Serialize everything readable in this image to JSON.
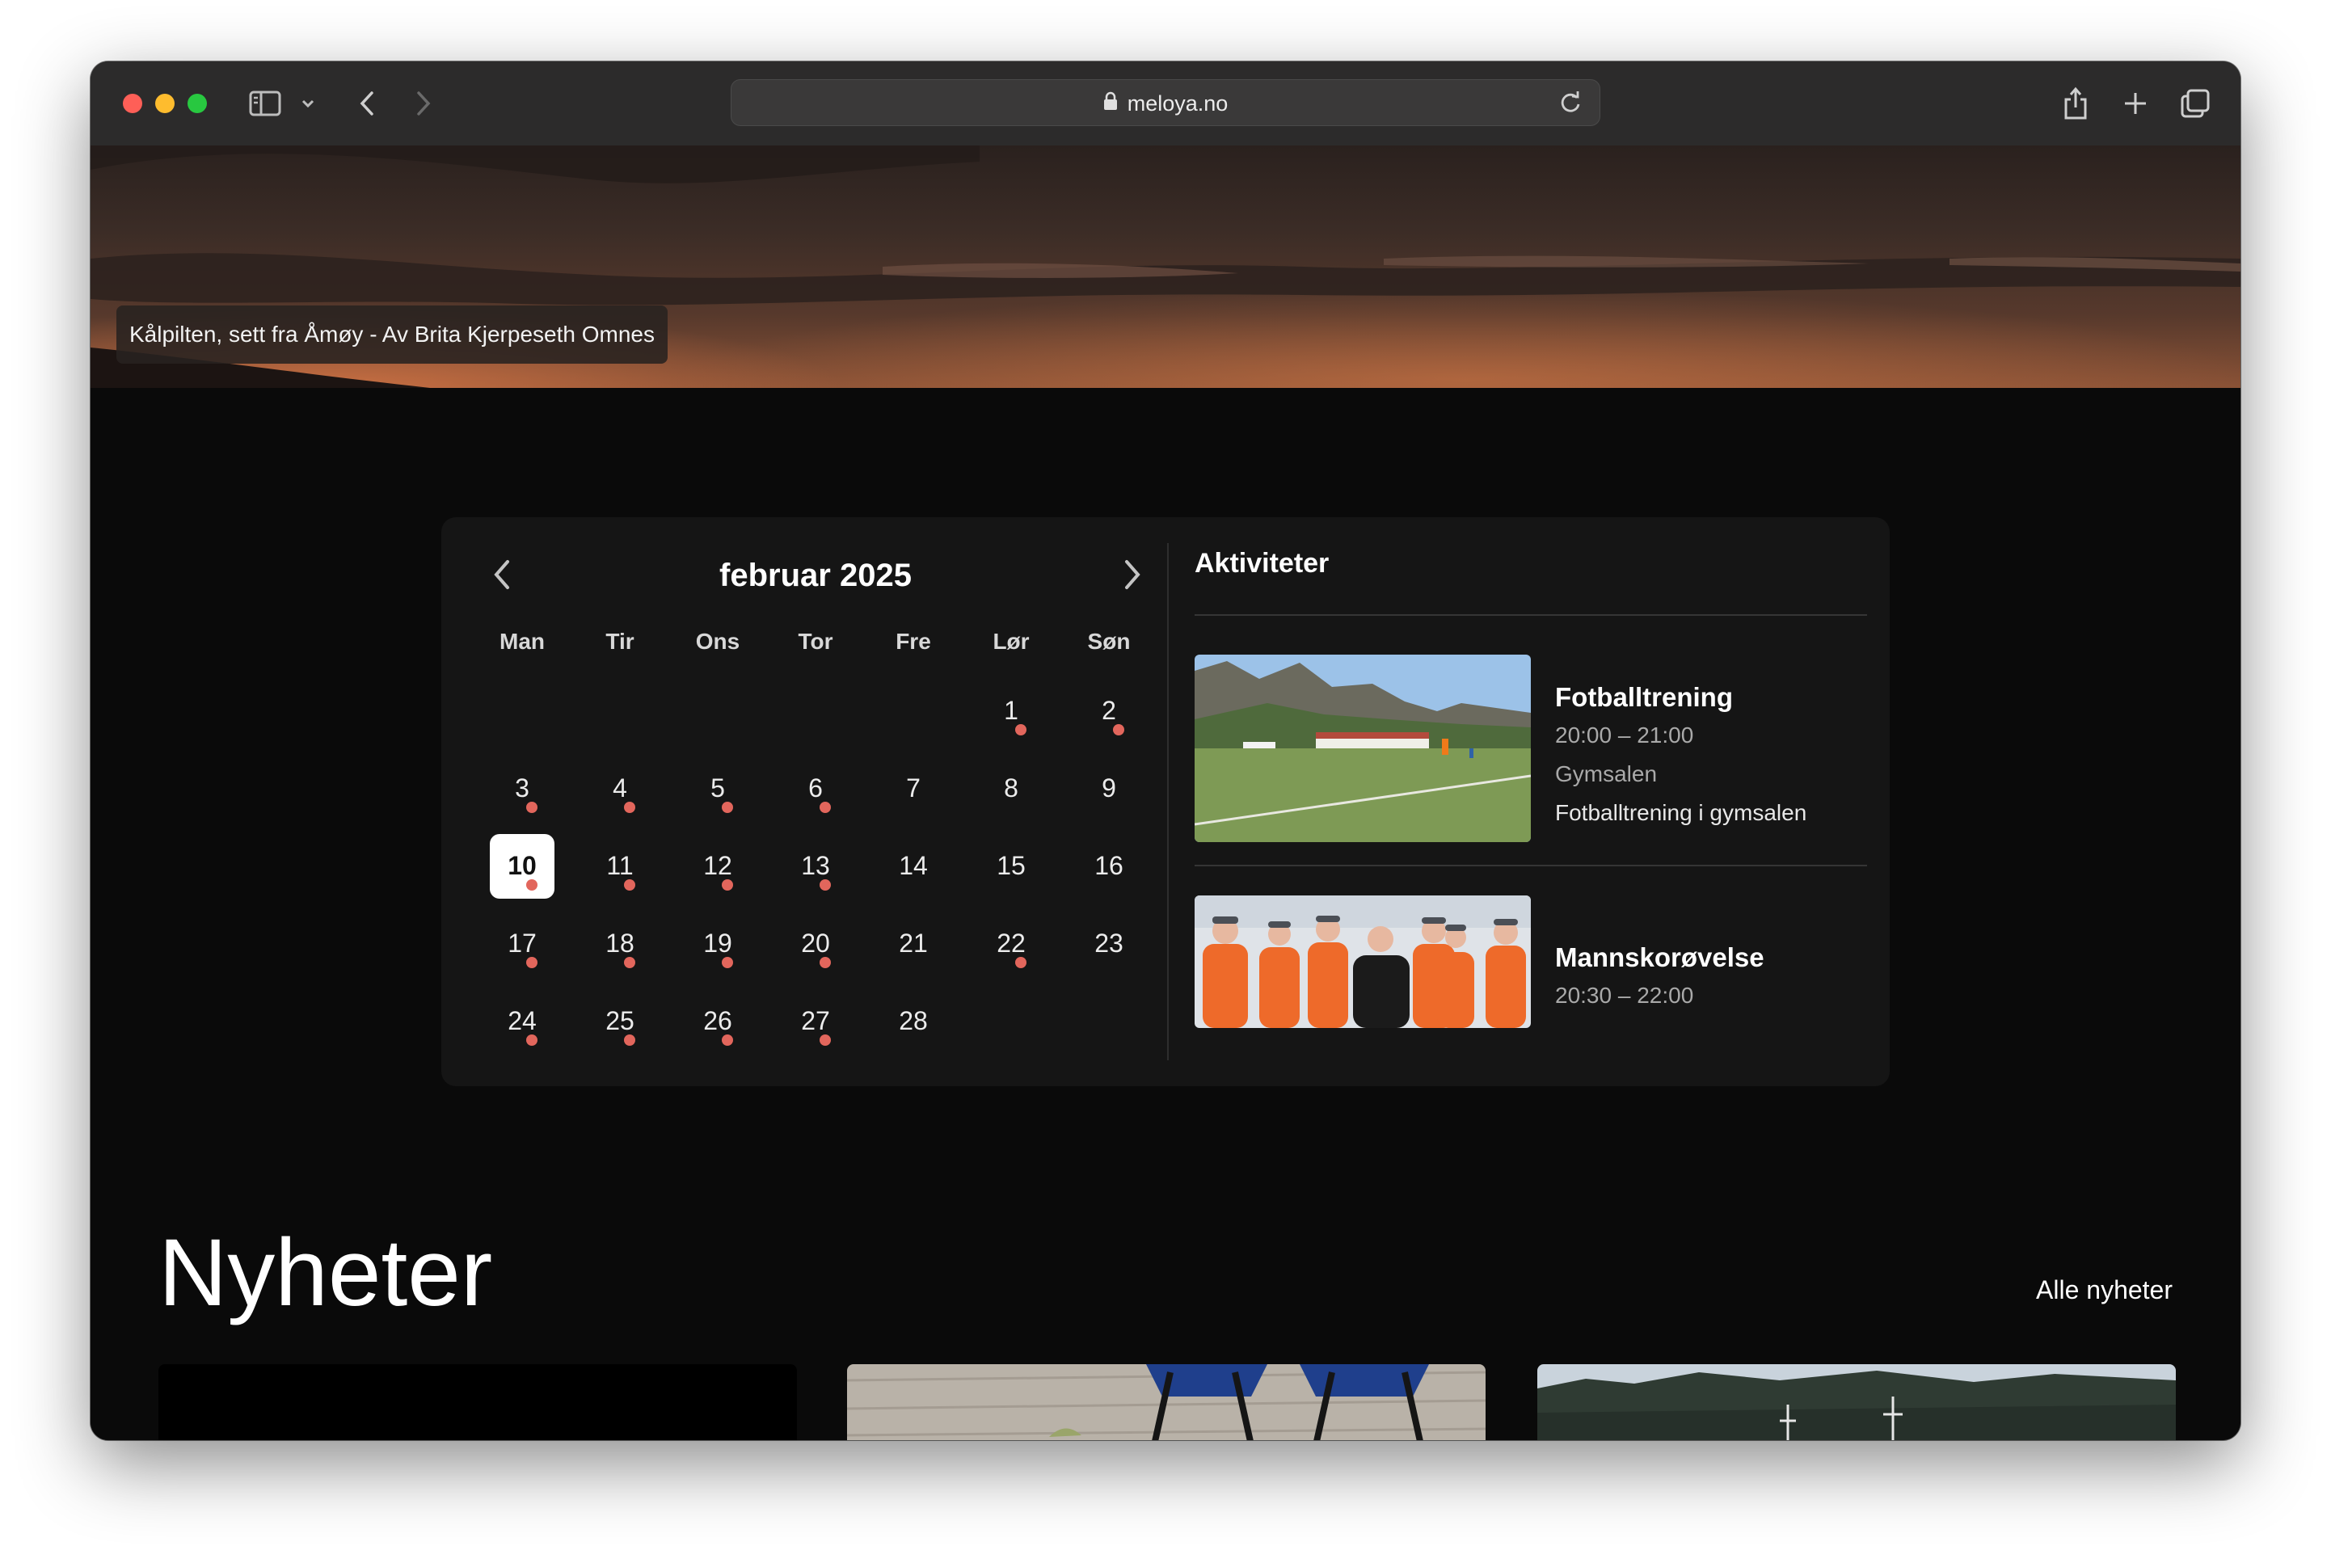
{
  "browser": {
    "url": "meloya.no"
  },
  "hero": {
    "caption": "Kålpilten, sett fra Åmøy - Av Brita Kjerpeseth Omnes"
  },
  "calendar": {
    "month_title": "februar 2025",
    "weekdays": [
      "Man",
      "Tir",
      "Ons",
      "Tor",
      "Fre",
      "Lør",
      "Søn"
    ],
    "today": "10",
    "days": [
      {
        "label": "1",
        "event": true
      },
      {
        "label": "2",
        "event": true
      },
      {
        "label": "3",
        "event": true
      },
      {
        "label": "4",
        "event": true
      },
      {
        "label": "5",
        "event": true
      },
      {
        "label": "6",
        "event": true
      },
      {
        "label": "7",
        "event": false
      },
      {
        "label": "8",
        "event": false
      },
      {
        "label": "9",
        "event": false
      },
      {
        "label": "10",
        "event": true
      },
      {
        "label": "11",
        "event": true
      },
      {
        "label": "12",
        "event": true
      },
      {
        "label": "13",
        "event": true
      },
      {
        "label": "14",
        "event": false
      },
      {
        "label": "15",
        "event": false
      },
      {
        "label": "16",
        "event": false
      },
      {
        "label": "17",
        "event": true
      },
      {
        "label": "18",
        "event": true
      },
      {
        "label": "19",
        "event": true
      },
      {
        "label": "20",
        "event": true
      },
      {
        "label": "21",
        "event": false
      },
      {
        "label": "22",
        "event": true
      },
      {
        "label": "23",
        "event": false
      },
      {
        "label": "24",
        "event": true
      },
      {
        "label": "25",
        "event": true
      },
      {
        "label": "26",
        "event": true
      },
      {
        "label": "27",
        "event": true
      },
      {
        "label": "28",
        "event": false
      }
    ],
    "dot_color": "#e2665c"
  },
  "activities": {
    "title": "Aktiviteter",
    "items": [
      {
        "name": "Fotballtrening",
        "time": "20:00 – 21:00",
        "location": "Gymsalen",
        "description": "Fotballtrening i gymsalen"
      },
      {
        "name": "Mannskorøvelse",
        "time": "20:30 – 22:00"
      }
    ]
  },
  "news": {
    "title": "Nyheter",
    "all_link": "Alle nyheter"
  },
  "icons": [
    "lock-icon",
    "reload-icon",
    "sidebar-icon",
    "chevron-down-icon",
    "back-icon",
    "forward-icon",
    "share-icon",
    "new-tab-icon",
    "tab-overview-icon",
    "prev-month-icon",
    "next-month-icon"
  ]
}
